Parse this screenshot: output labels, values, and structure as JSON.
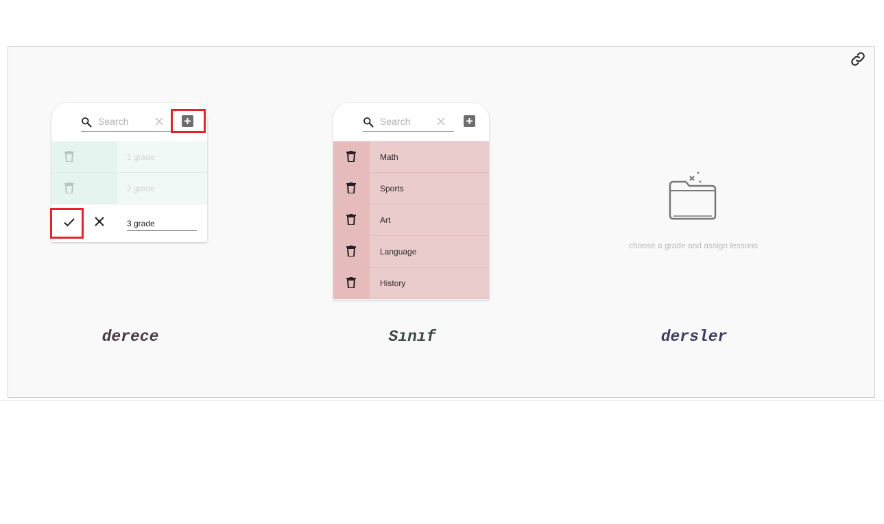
{
  "grade_panel": {
    "search_placeholder": "Search",
    "rows": [
      {
        "label": "1 grade"
      },
      {
        "label": "2 grade"
      }
    ],
    "edit_value": "3 grade",
    "title": "derece"
  },
  "class_panel": {
    "search_placeholder": "Search",
    "rows": [
      {
        "label": "Math"
      },
      {
        "label": "Sports"
      },
      {
        "label": "Art"
      },
      {
        "label": "Language"
      },
      {
        "label": "History"
      }
    ],
    "title": "Sınıf"
  },
  "lessons_panel": {
    "empty_message": "choose a grade and assign lessons",
    "title": "dersler"
  },
  "colors": {
    "highlight": "#e3242b",
    "grade_row_bg": "#f1f9f6",
    "class_row_bg": "#ebcccc",
    "frame_bg": "#f9f9f9"
  },
  "icons": {
    "link": "link-icon",
    "search": "search-icon",
    "clear": "close-icon",
    "add": "add-box-icon",
    "delete": "trash-icon",
    "confirm": "check-icon",
    "cancel": "close-icon",
    "empty": "folder-icon"
  }
}
